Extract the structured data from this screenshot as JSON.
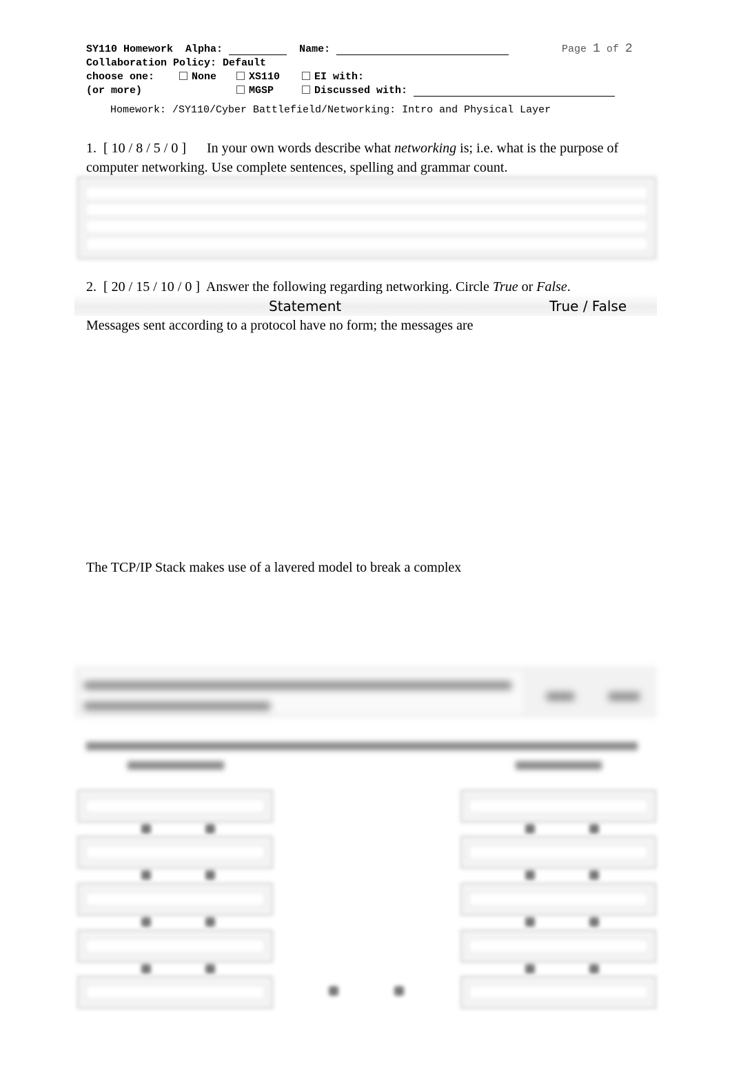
{
  "header": {
    "course_title": "SY110 Homework",
    "alpha_label": "Alpha:",
    "name_label": "Name:",
    "page_label": "Page",
    "page_current": "1",
    "page_of": "of",
    "page_total": "2",
    "collab_label": "Collaboration Policy: Default",
    "choose_label": "choose one:",
    "or_more_label": "(or more)",
    "options": [
      "None",
      "XS110",
      "EI with:",
      "MGSP",
      "Discussed with:"
    ],
    "homework_path": "Homework: /SY110/Cyber Battlefield/Networking: Intro and Physical Layer"
  },
  "q1": {
    "number": "1.",
    "points": "[ 10 / 8 / 5 / 0 ]",
    "text_a": "In your own words describe what",
    "text_em": "networking",
    "text_b": "is; i.e. what is the purpose of",
    "text_line2": "computer networking. Use complete sentences, spelling and grammar count."
  },
  "q2": {
    "number": "2.",
    "points": "[ 20 / 15 / 10 / 0 ]",
    "text_a": "Answer the following regarding networking. Circle",
    "true_em": "True",
    "or": "or",
    "false_em": "False",
    "col_statement": "Statement",
    "col_tf": "True / False",
    "statements": [
      "Messages sent according to a protocol have no form; the messages are",
      "The TCP/IP Stack makes use of a layered model to break a complex"
    ]
  }
}
